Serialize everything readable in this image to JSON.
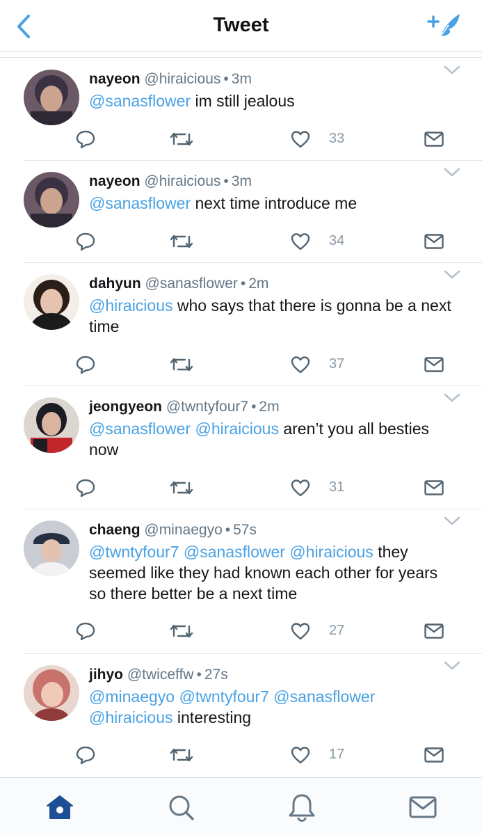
{
  "header": {
    "title": "Tweet"
  },
  "tweets": [
    {
      "name": "nayeon",
      "handle": "@hiraicious",
      "time": "3m",
      "mentions": "@sanasflower",
      "body": " im still jealous",
      "likes": "33",
      "avatar_colors": [
        "#3a3142",
        "#caa48f",
        "#6b5a66"
      ]
    },
    {
      "name": "nayeon",
      "handle": "@hiraicious",
      "time": "3m",
      "mentions": "@sanasflower",
      "body": " next time introduce me",
      "likes": "34",
      "avatar_colors": [
        "#3a3142",
        "#caa48f",
        "#6b5a66"
      ]
    },
    {
      "name": "dahyun",
      "handle": "@sanasflower",
      "time": "2m",
      "mentions": "@hiraicious",
      "body": " who says that there is gonna be a next time",
      "likes": "37",
      "avatar_colors": [
        "#2b1d17",
        "#e6c3ae",
        "#1b1b1b"
      ]
    },
    {
      "name": "jeongyeon",
      "handle": "@twntyfour7",
      "time": "2m",
      "mentions": "@sanasflower @hiraicious",
      "body": " aren’t you all besties now",
      "likes": "31",
      "avatar_colors": [
        "#1c1c24",
        "#d9b4a0",
        "#c0262b"
      ]
    },
    {
      "name": "chaeng",
      "handle": "@minaegyo",
      "time": "57s",
      "mentions": "@twntyfour7 @sanasflower @hiraicious",
      "body": " they seemed like they had known each other for years so there better be a next time",
      "likes": "27",
      "avatar_colors": [
        "#c9ccd3",
        "#e2c2b0",
        "#263043"
      ]
    },
    {
      "name": "jihyo",
      "handle": "@twiceffw",
      "time": "27s",
      "mentions": "@minaegyo @twntyfour7 @sanasflower @hiraicious",
      "body": " interesting",
      "likes": "17",
      "avatar_colors": [
        "#c7736c",
        "#f0c9b8",
        "#8f3b3b"
      ]
    }
  ],
  "tabbar": {
    "items": [
      "home-icon",
      "search-icon",
      "bell-icon",
      "mail-icon"
    ],
    "active_color": "#1d4f95",
    "inactive_color": "#657786"
  },
  "colors": {
    "accent": "#4aa2e4",
    "muted": "#8899a6"
  }
}
